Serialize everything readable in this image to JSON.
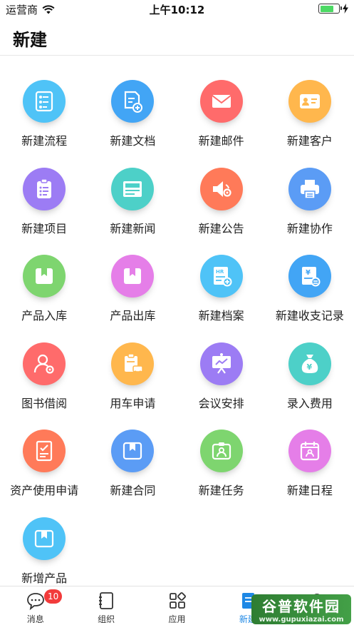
{
  "status_bar": {
    "carrier": "运营商",
    "time": "上午10:12"
  },
  "header": {
    "title": "新建"
  },
  "grid": {
    "items": [
      {
        "label": "新建流程",
        "icon": "flowchart-icon",
        "color": "#4fc3f7"
      },
      {
        "label": "新建文档",
        "icon": "document-add-icon",
        "color": "#42a5f5"
      },
      {
        "label": "新建邮件",
        "icon": "mail-icon",
        "color": "#ff6b6b"
      },
      {
        "label": "新建客户",
        "icon": "customer-card-icon",
        "color": "#ffb74d"
      },
      {
        "label": "新建项目",
        "icon": "clipboard-list-icon",
        "color": "#9c7cf4"
      },
      {
        "label": "新建新闻",
        "icon": "news-icon",
        "color": "#4dd0c8"
      },
      {
        "label": "新建公告",
        "icon": "announcement-speaker-icon",
        "color": "#ff7a59"
      },
      {
        "label": "新建协作",
        "icon": "printer-icon",
        "color": "#5b9cf5"
      },
      {
        "label": "产品入库",
        "icon": "box-in-icon",
        "color": "#7ed56f"
      },
      {
        "label": "产品出库",
        "icon": "box-out-icon",
        "color": "#e57ee8"
      },
      {
        "label": "新建档案",
        "icon": "hr-file-icon",
        "color": "#4fc3f7"
      },
      {
        "label": "新建收支记录",
        "icon": "ledger-yuan-icon",
        "color": "#42a5f5"
      },
      {
        "label": "图书借阅",
        "icon": "person-gear-icon",
        "color": "#ff6b6b"
      },
      {
        "label": "用车申请",
        "icon": "car-request-icon",
        "color": "#ffb74d"
      },
      {
        "label": "会议安排",
        "icon": "presentation-board-icon",
        "color": "#9c7cf4"
      },
      {
        "label": "录入费用",
        "icon": "money-bag-icon",
        "color": "#4dd0c8"
      },
      {
        "label": "资产使用申请",
        "icon": "checklist-doc-icon",
        "color": "#ff7a59"
      },
      {
        "label": "新建合同",
        "icon": "box-contract-icon",
        "color": "#5b9cf5"
      },
      {
        "label": "新建任务",
        "icon": "person-task-icon",
        "color": "#7ed56f"
      },
      {
        "label": "新建日程",
        "icon": "calendar-person-icon",
        "color": "#e57ee8"
      },
      {
        "label": "新增产品",
        "icon": "box-new-icon",
        "color": "#4fc3f7"
      }
    ]
  },
  "tab_bar": {
    "tabs": [
      {
        "label": "消息",
        "icon": "chat-bubble-icon",
        "badge": "10"
      },
      {
        "label": "组织",
        "icon": "notebook-icon"
      },
      {
        "label": "应用",
        "icon": "apps-grid-icon"
      },
      {
        "label": "新建",
        "icon": "new-doc-icon"
      },
      {
        "label": "",
        "icon": "search-icon"
      }
    ]
  },
  "watermark": {
    "main": "谷普软件园",
    "sub": "www.gupuxiazai.com"
  }
}
